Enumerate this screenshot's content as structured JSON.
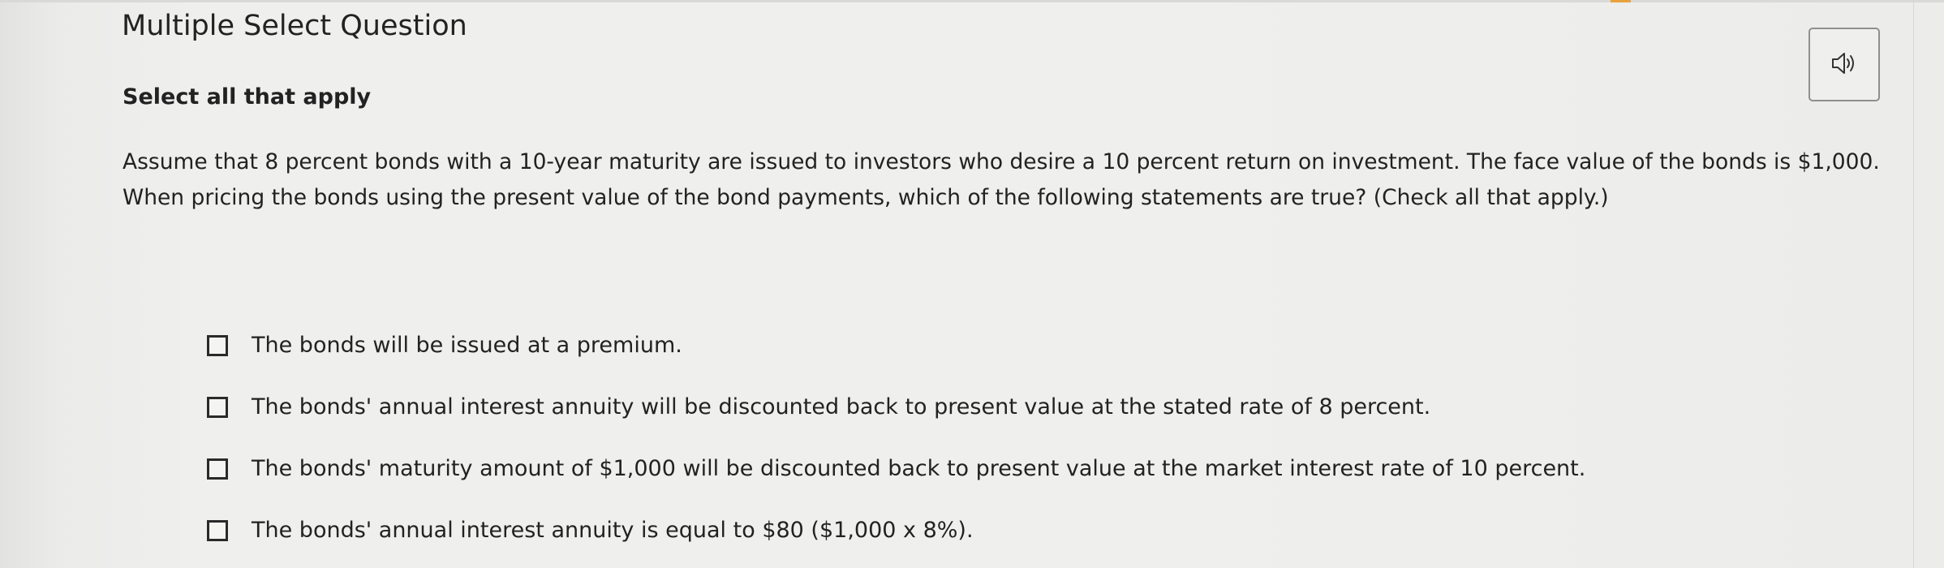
{
  "question": {
    "title": "Multiple Select Question",
    "subtitle": "Select all that apply",
    "stem_lines": [
      "Assume that 8 percent bonds with a 10-year maturity are issued to investors who desire a 10 percent return on investment. The face value of the bonds is $1,000.",
      "When pricing the bonds using the present value of the bond payments, which of the following statements are true? (Check all that apply.)"
    ]
  },
  "toolbar": {
    "audio_icon": "speaker-icon"
  },
  "options": [
    {
      "label": "The bonds will be issued at a premium.",
      "checked": false
    },
    {
      "label": "The bonds' annual interest annuity will be discounted back to present value at the stated rate of 8 percent.",
      "checked": false
    },
    {
      "label": "The bonds' maturity amount of $1,000 will be discounted back to present value at the market interest rate of 10 percent.",
      "checked": false
    },
    {
      "label": "The bonds' annual interest annuity is equal to $80 ($1,000 x 8%).",
      "checked": false
    }
  ],
  "colors": {
    "text": "#222222",
    "background": "#efefee",
    "accent": "#e8a23d"
  }
}
